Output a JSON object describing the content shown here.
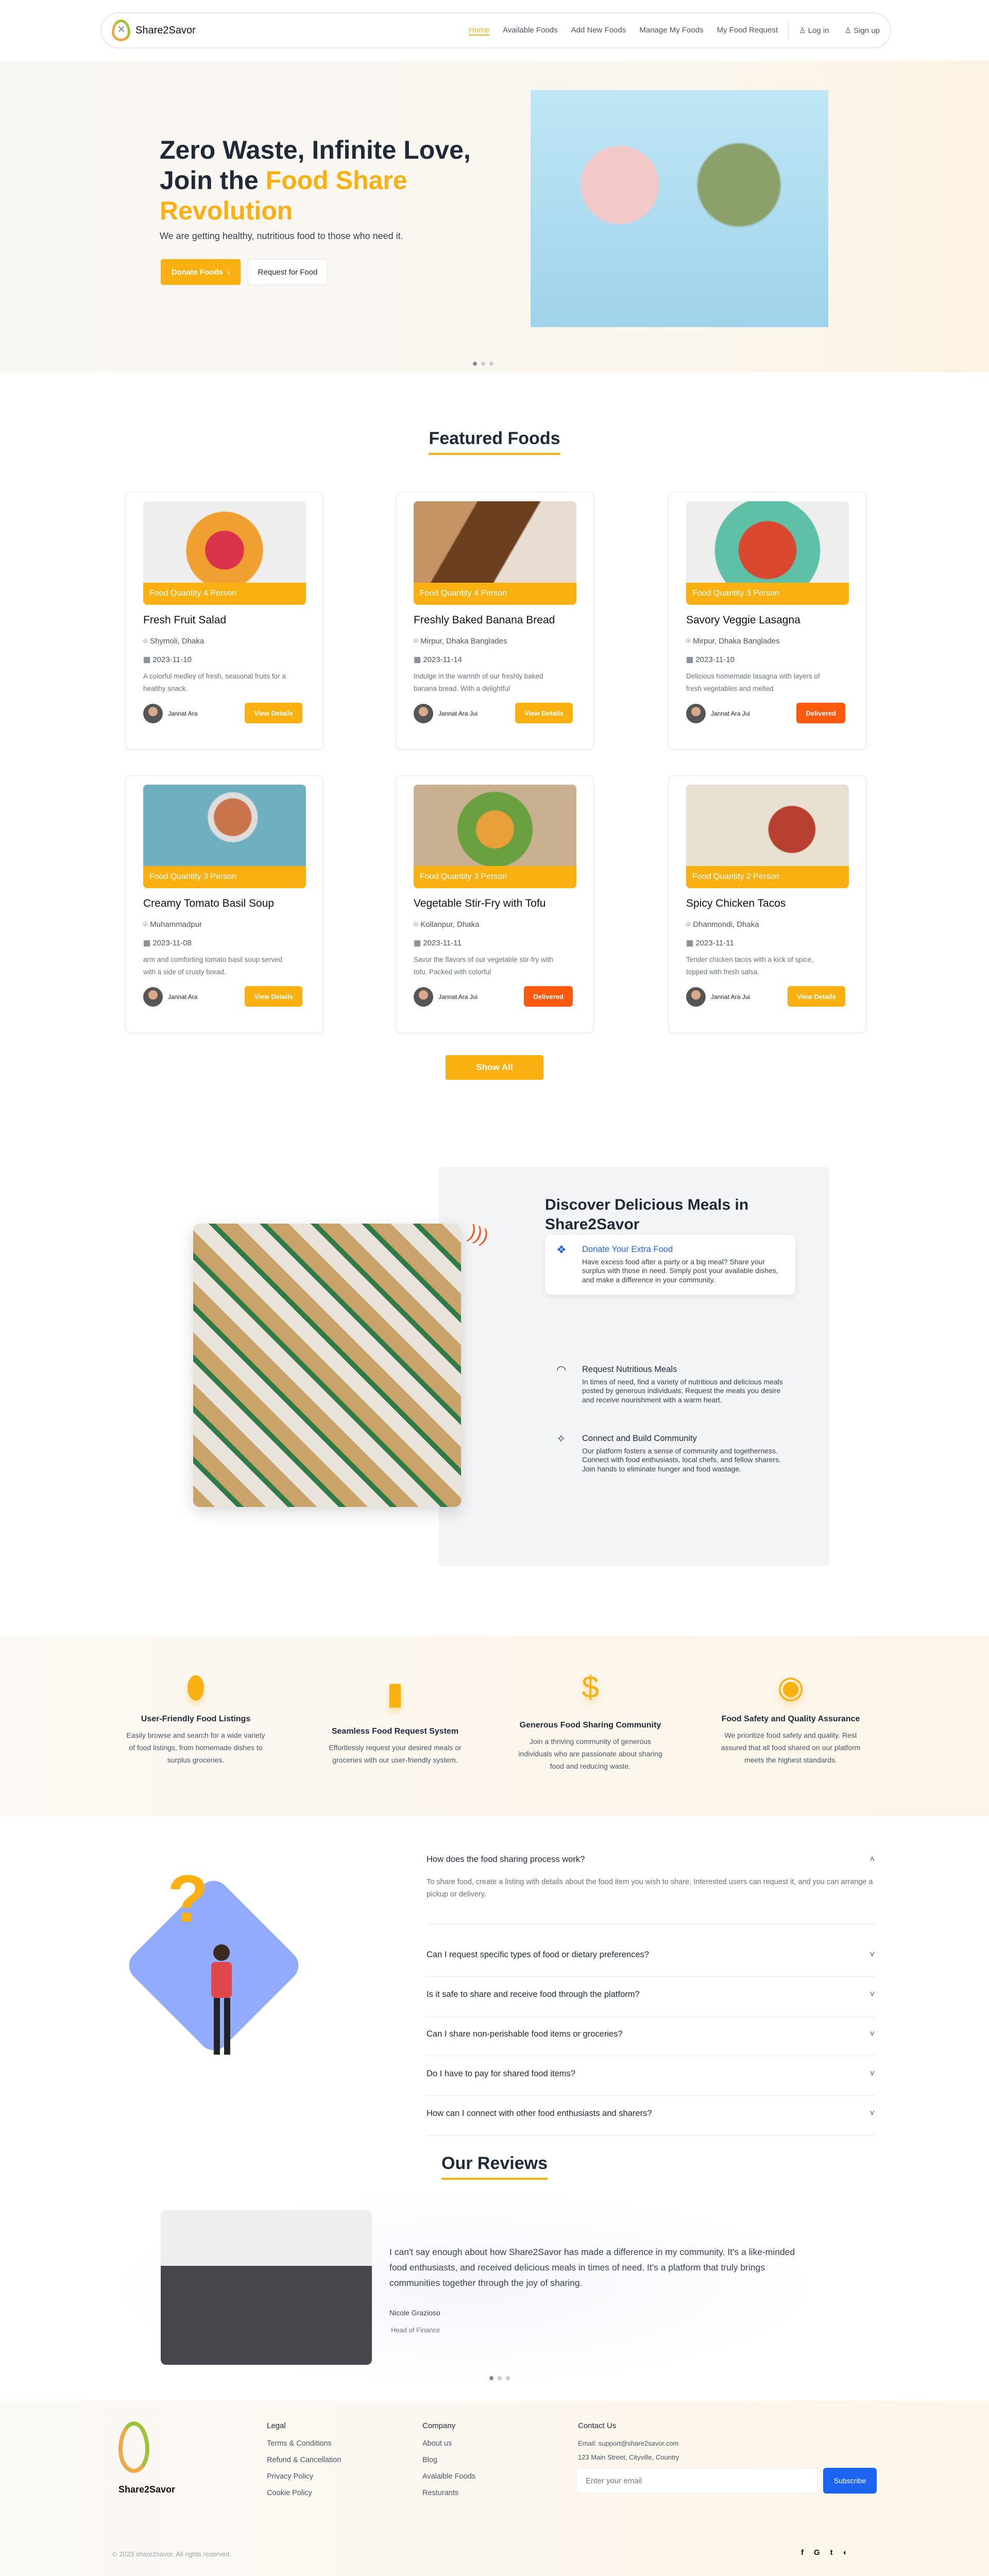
{
  "nav": {
    "brand": "Share2Savor",
    "links": [
      "Home",
      "Available Foods",
      "Add New Foods",
      "Manage My Foods",
      "My Food Request"
    ],
    "login": "Log in",
    "signup": "Sign up"
  },
  "hero": {
    "title_a": "Zero Waste, Infinite Love, Join the ",
    "title_b": "Food Share Revolution",
    "subtitle": "We are getting healthy, nutritious food to those who need it.",
    "donate": "Donate Foods",
    "request": "Request for Food"
  },
  "featured": {
    "title": "Featured Foods",
    "show_all": "Show All",
    "foods": [
      {
        "qty": "Food Quantity 4 Person",
        "name": "Fresh Fruit Salad",
        "location": "Shymoli, Dhaka",
        "date": "2023-11-10",
        "desc": "A colorful medley of fresh, seasonal fruits for a healthy snack.",
        "owner": "Jannat Ara",
        "action": "View Details"
      },
      {
        "qty": "Food Quantity 4 Person",
        "name": "Freshly Baked Banana Bread",
        "location": "Mirpur, Dhaka Banglades",
        "date": "2023-11-14",
        "desc": "Indulge in the warmth of our freshly baked banana bread. With a delightful",
        "owner": "Jannat Ara Jui",
        "action": "View Details"
      },
      {
        "qty": "Food Quantity 3 Person",
        "name": "Savory Veggie Lasagna",
        "location": "Mirpur, Dhaka Banglades",
        "date": "2023-11-10",
        "desc": "Delicious homemade lasagna with layers of fresh vegetables and melted",
        "owner": "Jannat Ara Jui",
        "action": "Delivered"
      },
      {
        "qty": "Food Quantity 3 Person",
        "name": "Creamy Tomato Basil Soup",
        "location": "Muhammadpur",
        "date": "2023-11-08",
        "desc": "arm and comforting tomato basil soup served with a side of crusty bread.",
        "owner": "Jannat Ara",
        "action": "View Details"
      },
      {
        "qty": "Food Quantity 3 Person",
        "name": "Vegetable Stir-Fry with Tofu",
        "location": "Kollanpur, Dhaka",
        "date": "2023-11-11",
        "desc": "Savor the flavors of our vegetable stir-fry with tofu. Packed with colorful",
        "owner": "Jannat Ara Jui",
        "action": "Delivered"
      },
      {
        "qty": "Food Quantity 2 Person",
        "name": "Spicy Chicken Tacos",
        "location": "Dhanmondi, Dhaka",
        "date": "2023-11-11",
        "desc": "Tender chicken tacos with a kick of spice, topped with fresh salsa.",
        "owner": "Jannat Ara Jui",
        "action": "View Details"
      }
    ]
  },
  "discover": {
    "title": "Discover Delicious Meals in Share2Savor",
    "items": [
      {
        "title": "Donate Your Extra Food",
        "text": "Have excess food after a party or a big meal? Share your surplus with those in need. Simply post your available dishes, and make a difference in your community."
      },
      {
        "title": "Request Nutritious Meals",
        "text": "In times of need, find a variety of nutritious and delicious meals posted by generous individuals. Request the meals you desire and receive nourishment with a warm heart."
      },
      {
        "title": "Connect and Build Community",
        "text": "Our platform fosters a sense of community and togetherness. Connect with food enthusiasts, local chefs, and fellow sharers. Join hands to eliminate hunger and food wastage."
      }
    ]
  },
  "features": [
    {
      "title": "User-Friendly Food Listings",
      "text": "Easily browse and search for a wide variety of food listings, from homemade dishes to surplus groceries."
    },
    {
      "title": "Seamless Food Request System",
      "text": "Effortlessly request your desired meals or groceries with our user-friendly system."
    },
    {
      "title": "Generous Food Sharing Community",
      "text": "Join a thriving community of generous individuals who are passionate about sharing food and reducing waste."
    },
    {
      "title": "Food Safety and Quality Assurance",
      "text": "We prioritize food safety and quality. Rest assured that all food shared on our platform meets the highest standards."
    }
  ],
  "faq": [
    {
      "q": "How does the food sharing process work?",
      "a": "To share food, create a listing with details about the food item you wish to share. Interested users can request it, and you can arrange a pickup or delivery."
    },
    {
      "q": "Can I request specific types of food or dietary preferences?"
    },
    {
      "q": "Is it safe to share and receive food through the platform?"
    },
    {
      "q": "Can I share non-perishable food items or groceries?"
    },
    {
      "q": "Do I have to pay for shared food items?"
    },
    {
      "q": "How can I connect with other food enthusiasts and sharers?"
    }
  ],
  "reviews": {
    "title": "Our Reviews",
    "text": "I can't say enough about how Share2Savor has made a difference in my community. It's a like-minded food enthusiasts, and received delicious meals in times of need. It's a platform that truly brings communities together through the joy of sharing.",
    "name": "Nicole Grazioso",
    "role": "Head of Finance"
  },
  "footer": {
    "brand": "Share2Savor",
    "legal": {
      "title": "Legal",
      "links": [
        "Terms & Conditions",
        "Refund & Cancellation",
        "Privacy Policy",
        "Cookie Policy"
      ]
    },
    "company": {
      "title": "Company",
      "links": [
        "About us",
        "Blog",
        "Avalaible Foods",
        "Resturants"
      ]
    },
    "contact": {
      "title": "Contact Us",
      "email": "Email: support@share2savor.com",
      "address": "123 Main Street, Cityville, Country"
    },
    "email_placeholder": "Enter your email",
    "subscribe": "Subscribe",
    "copyright": "© 2023 share2savor. All rights reserved.",
    "social": [
      "facebook-icon",
      "google-icon",
      "twitter-icon",
      "github-icon"
    ]
  },
  "colors": {
    "accent": "#fbb012",
    "delivered": "#fd5a10",
    "blue": "#2563eb"
  }
}
